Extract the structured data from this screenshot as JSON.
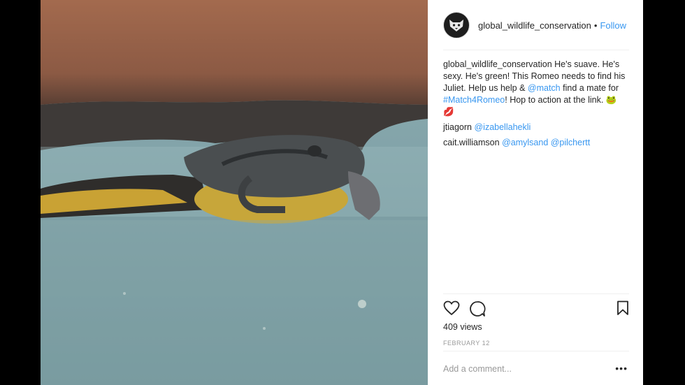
{
  "post": {
    "username": "global_wildlife_conservation",
    "dot": "•",
    "follow": "Follow",
    "caption_user": "global_wildlife_conservation",
    "caption_text_1": " He's suave. He's sexy. He's green! This Romeo needs to find his Juliet. Help us help & ",
    "caption_mention": "@match",
    "caption_text_2": " find a mate for ",
    "caption_hashtag": "#Match4Romeo",
    "caption_text_3": "! Hop to action at the link. 🐸 💋",
    "comments": [
      {
        "user": "jtiagorn",
        "mentions": "@izabellahekli"
      },
      {
        "user": "cait.williamson",
        "mentions": "@amylsand @pilchertt"
      }
    ],
    "views": "409 views",
    "date": "FEBRUARY 12",
    "add_comment_placeholder": "Add a comment...",
    "more": "•••"
  },
  "icons": {
    "avatar": "panther-avatar-icon",
    "like": "heart-icon",
    "comment": "comment-bubble-icon",
    "save": "bookmark-icon"
  },
  "colors": {
    "link": "#3897f0",
    "text": "#262626",
    "muted": "#999999"
  }
}
